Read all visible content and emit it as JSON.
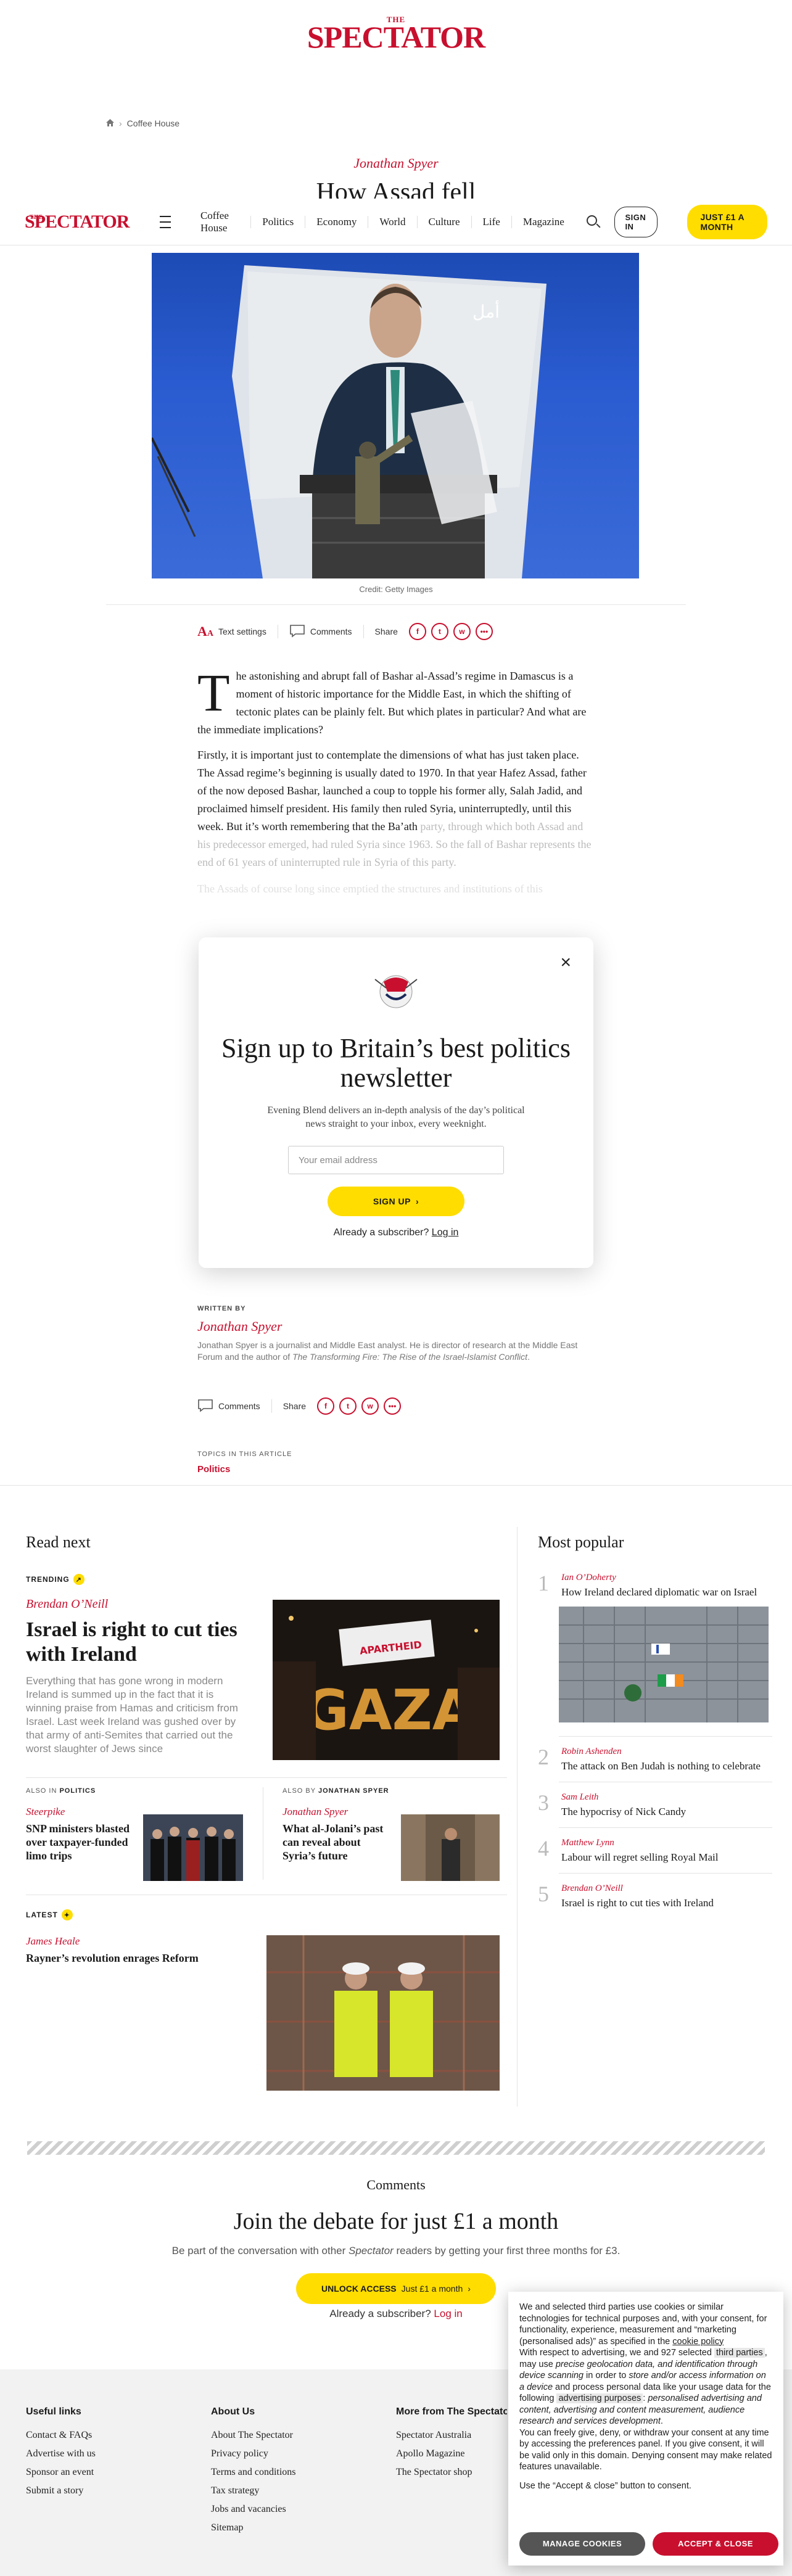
{
  "brand": {
    "the": "THE",
    "name": "SPECTATOR"
  },
  "breadcrumb": {
    "section": "Coffee House"
  },
  "article": {
    "author": "Jonathan Spyer",
    "headline": "How Assad fell",
    "image_credit": "Credit: Getty Images",
    "poster_text": "أمل",
    "p1": "he astonishing and abrupt fall of Bashar al-Assad’s regime in Damascus is a moment of historic importance for the Middle East, in which the shifting of tectonic plates can be plainly felt. But which plates in particular? And what are the immediate implications?",
    "p1_dropcap": "T",
    "p2a": "Firstly, it is important just to contemplate the dimensions of what has just taken place. The Assad regime’s beginning is usually dated to 1970.  In that year Hafez Assad, father of the now deposed Bashar, launched a coup to topple his former ally, Salah Jadid, and proclaimed himself president. His family then ruled Syria, uninterruptedly, until this week. But it’s worth remembering that the Ba’ath",
    "p2b": "party, through which both Assad and his predecessor emerged, had ruled Syria since 1963. So the fall of Bashar represents the end of 61 years of uninterrupted rule in Syria of this party.",
    "p3": "The Assads of course long since emptied the structures and institutions of this"
  },
  "nav": {
    "links": [
      "Coffee House",
      "Politics",
      "Economy",
      "World",
      "Culture",
      "Life",
      "Magazine"
    ],
    "sign_in": "SIGN IN",
    "subscribe": "JUST £1 A MONTH"
  },
  "toolbar": {
    "text_settings": "Text settings",
    "comments": "Comments",
    "share": "Share"
  },
  "share_icons": [
    "f",
    "t",
    "w",
    "•••"
  ],
  "modal": {
    "title": "Sign up to Britain’s best politics newsletter",
    "desc": "Evening Blend delivers an in-depth analysis of the day’s political news straight to your inbox, every weeknight.",
    "email_placeholder": "Your email address",
    "signup": "SIGN UP",
    "already": "Already a subscriber?",
    "login": "Log in"
  },
  "written_by": {
    "label": "WRITTEN BY",
    "author": "Jonathan Spyer",
    "bio_a": "Jonathan Spyer is a journalist and Middle East analyst. He is director of research at the Middle East Forum and the author of ",
    "bio_book": "The Transforming Fire: The Rise of the Israel-Islamist Conflict",
    "bio_end": "."
  },
  "topics": {
    "label": "TOPICS IN THIS ARTICLE",
    "item": "Politics"
  },
  "read_next": {
    "title": "Read next",
    "trending_label": "TRENDING",
    "main": {
      "author": "Brendan O’Neill",
      "headline": "Israel is right to cut ties with Ireland",
      "teaser": "Everything that has gone wrong in modern Ireland is summed up in the fact that it is winning praise from Hamas and criticism from Israel. Last week Ireland was gushed over by that army of anti-Semites that carried out the worst slaughter of Jews since",
      "sign_text": "APARTHEID",
      "gaza_text": "GAZA"
    },
    "also_in": {
      "label_pre": "ALSO IN",
      "label_topic": "POLITICS",
      "author": "Steerpike",
      "headline": "SNP ministers blasted over taxpayer-funded limo trips"
    },
    "also_by": {
      "label_pre": "ALSO BY",
      "label_author": "JONATHAN SPYER",
      "author": "Jonathan Spyer",
      "headline": "What al-Jolani’s past can reveal about Syria’s future"
    },
    "latest": {
      "label": "LATEST",
      "author": "James Heale",
      "headline": "Rayner’s revolution enrages Reform"
    }
  },
  "most_popular": {
    "title": "Most popular",
    "items": [
      {
        "num": "1",
        "author": "Ian O’Doherty",
        "title": "How Ireland declared diplomatic war on Israel"
      },
      {
        "num": "2",
        "author": "Robin Ashenden",
        "title": "The attack on Ben Judah is nothing to celebrate"
      },
      {
        "num": "3",
        "author": "Sam Leith",
        "title": "The hypocrisy of Nick Candy"
      },
      {
        "num": "4",
        "author": "Matthew Lynn",
        "title": "Labour will regret selling Royal Mail"
      },
      {
        "num": "5",
        "author": "Brendan O’Neill",
        "title": "Israel is right to cut ties with Ireland"
      }
    ]
  },
  "comments": {
    "title": "Comments",
    "headline": "Join the debate for just £1 a month",
    "sub_a": "Be part of the conversation with other ",
    "sub_brand": "Spectator",
    "sub_b": " readers by getting your first three months for £3.",
    "unlock": "UNLOCK ACCESS",
    "unlock_price": "Just £1 a month",
    "already": "Already a subscriber?",
    "login": "Log in"
  },
  "footer": {
    "useful": {
      "title": "Useful links",
      "items": [
        "Contact & FAQs",
        "Advertise with us",
        "Sponsor an event",
        "Submit a story"
      ]
    },
    "about": {
      "title": "About Us",
      "items": [
        "About The Spectator",
        "Privacy policy",
        "Terms and conditions",
        "Tax strategy",
        "Jobs and vacancies",
        "Sitemap"
      ]
    },
    "more": {
      "title": "More from The Spectator",
      "items": [
        "Spectator Australia",
        "Apollo Magazine",
        "The Spectator shop"
      ]
    }
  },
  "cookie": {
    "p1": "We and selected third parties use cookies or similar technologies for technical purposes and, with your consent, for functionality, experience, measurement and “marketing (personalised ads)” as specified in the ",
    "p1_link": "cookie policy",
    "p2a": "With respect to advertising, we and 927 selected ",
    "p2_hl1": "third parties",
    "p2b": ", may use ",
    "p2_i1": "precise geolocation data, and identification through device scanning",
    "p2c": " in order to ",
    "p2_i2": "store and/or access information on a device",
    "p2d": " and process personal data like your usage data for the following ",
    "p2_hl2": "advertising purposes",
    "p2e": ": ",
    "p2_i3": "personalised advertising and content, advertising and content measurement, audience research and services development",
    "p2f": ".",
    "p3": "You can freely give, deny, or withdraw your consent at any time by accessing the preferences panel. If you give consent, it will be valid only in this domain. Denying consent may make related features unavailable.",
    "p4": "Use the “Accept & close” button to consent.",
    "manage": "MANAGE COOKIES",
    "accept": "ACCEPT & CLOSE"
  },
  "colors": {
    "accent_red": "#c8102e",
    "subscribe_yellow": "#ffdd00",
    "cookie_gray": "#555555"
  }
}
